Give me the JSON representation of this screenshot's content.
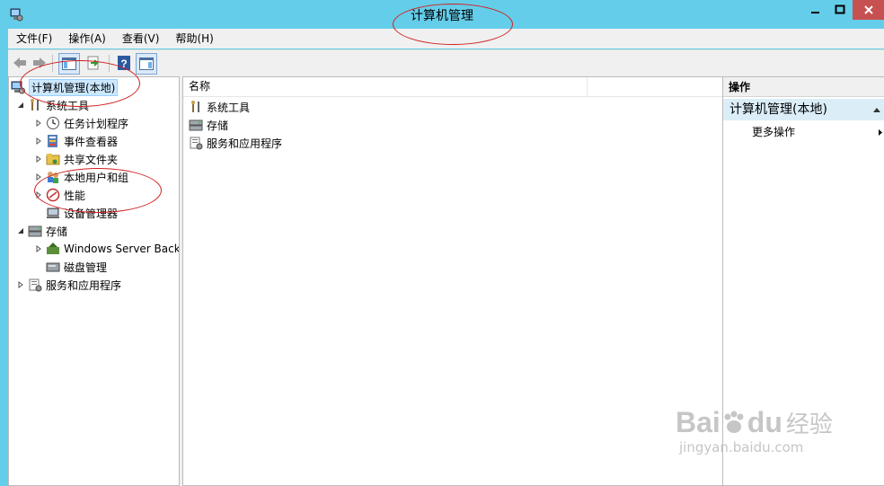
{
  "window": {
    "title": "计算机管理"
  },
  "menu": [
    {
      "label": "文件(F)"
    },
    {
      "label": "操作(A)"
    },
    {
      "label": "查看(V)"
    },
    {
      "label": "帮助(H)"
    }
  ],
  "tree": {
    "root": "计算机管理(本地)",
    "system_tools": "系统工具",
    "task_scheduler": "任务计划程序",
    "event_viewer": "事件查看器",
    "shared_folders": "共享文件夹",
    "local_users": "本地用户和组",
    "performance": "性能",
    "device_manager": "设备管理器",
    "storage": "存储",
    "windows_backup": "Windows Server Back",
    "disk_management": "磁盘管理",
    "services_apps": "服务和应用程序"
  },
  "list": {
    "column_name": "名称",
    "items": [
      "系统工具",
      "存储",
      "服务和应用程序"
    ]
  },
  "actions": {
    "header": "操作",
    "section": "计算机管理(本地)",
    "more": "更多操作"
  },
  "watermark": {
    "brand": "Bai",
    "brand2": "du",
    "cn": "经验",
    "url": "jingyan.baidu.com"
  },
  "colors": {
    "titlebar": "#64cde9",
    "close": "#c75050",
    "annotation": "#d02020",
    "selection": "#cce8ff"
  }
}
